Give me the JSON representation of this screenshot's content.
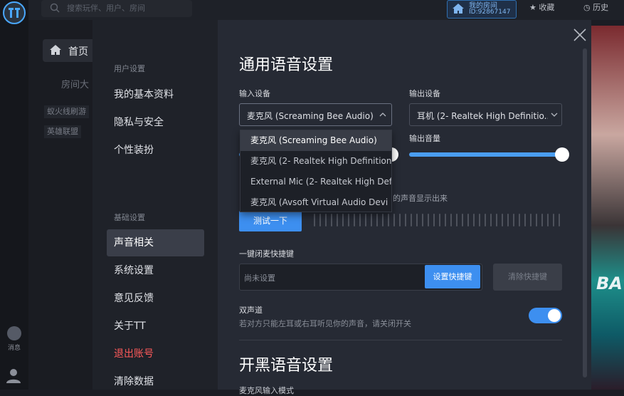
{
  "app": {
    "search_placeholder": "搜索玩伴、用户、房间",
    "my_room_label": "我的房间",
    "my_room_id": "ID:92867147",
    "favorites": "收藏",
    "history": "历史",
    "nav_home": "首页",
    "nav_room_hall": "房间大",
    "tags": [
      "蚁火线刷游",
      "英雄联盟"
    ],
    "rail_message": "消息",
    "accent": "#3d8ff0"
  },
  "sidebar": {
    "section_user": "用户设置",
    "user_items": [
      "我的基本资料",
      "隐私与安全",
      "个性装扮"
    ],
    "section_basic": "基础设置",
    "basic_items": [
      "声音相关",
      "系统设置",
      "意见反馈",
      "关于TT"
    ],
    "logout": "退出账号",
    "clear_data": "清除数据",
    "active_item": "声音相关"
  },
  "voice": {
    "title": "通用语音设置",
    "input_label": "输入设备",
    "input_value": "麦克风 (Screaming Bee Audio)",
    "output_label": "输出设备",
    "output_value": "耳机 (2- Realtek High Definitio...",
    "output_volume_label": "输出音量",
    "output_volume": 1.0,
    "input_volume": 1.0,
    "mic_test_hint": "的声音显示出来",
    "test_button": "测试一下",
    "hotkey_label": "一键闭麦快捷键",
    "hotkey_placeholder": "尚未设置",
    "set_hotkey_button": "设置快捷键",
    "clear_hotkey_button": "清除快捷键",
    "stereo_label": "双声道",
    "stereo_desc": "若对方只能左耳或右耳听见你的声音，请关闭开关",
    "stereo_enabled": true,
    "dropdown_options": [
      "麦克风 (Screaming Bee Audio)",
      "麦克风 (2- Realtek High Definition",
      "External Mic (2- Realtek High Def",
      "麦克风 (Avsoft Virtual Audio Devi"
    ]
  },
  "game_voice": {
    "title": "开黑语音设置",
    "next_label": "麦克风输入模式"
  }
}
